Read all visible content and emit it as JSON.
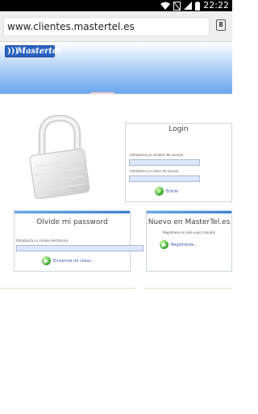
{
  "status": {
    "time": "22:22"
  },
  "browser": {
    "url": "www.clientes.mastertel.es",
    "tab_count": "8"
  },
  "brand": {
    "logo_text": "Mastertel"
  },
  "login": {
    "title": "Login",
    "user_label": "Introduzca su nombre de usuario",
    "password_label": "Introduzca su clave de acceso",
    "submit_label": "Entrar"
  },
  "forgot": {
    "title": "Olvide mi password",
    "email_label": "Introduzca su correo electronico",
    "submit_label": "Enviarme mi clave..."
  },
  "signup": {
    "title": "Nuevo en MasterTel.es",
    "subtitle": "Registrese en solo unos minutos",
    "link_label": "Registrarse..."
  }
}
